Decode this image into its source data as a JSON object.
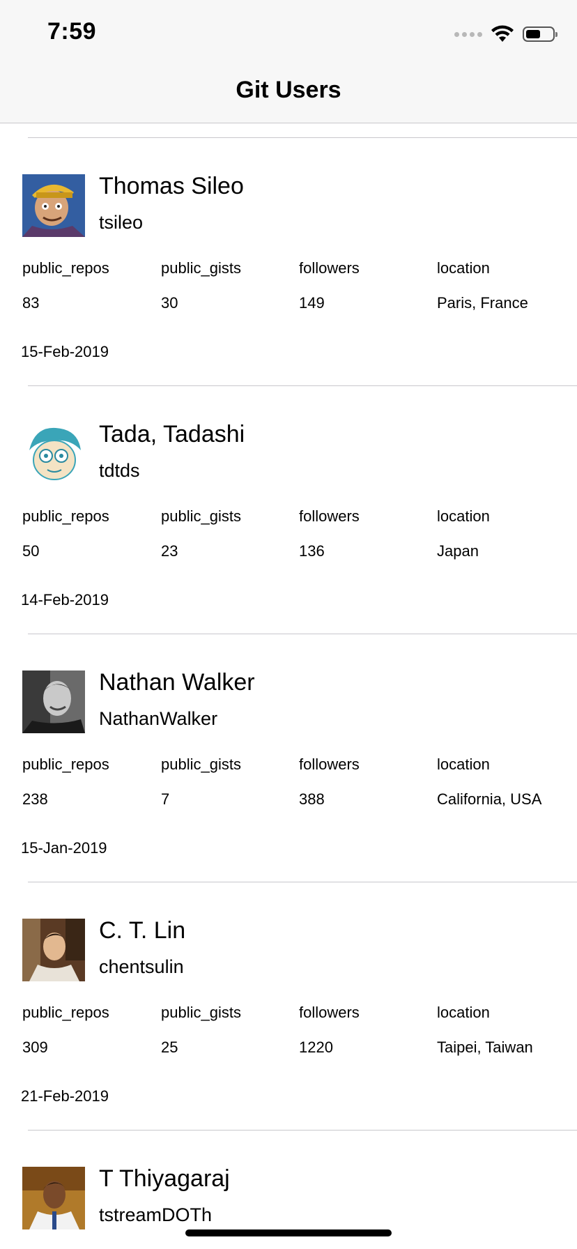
{
  "status_bar": {
    "time": "7:59"
  },
  "nav": {
    "title": "Git Users"
  },
  "users": [
    {
      "name": "Thomas Sileo",
      "login": "tsileo",
      "labels": [
        "public_repos",
        "public_gists",
        "followers",
        "location"
      ],
      "values": [
        "83",
        "30",
        "149",
        "Paris, France"
      ],
      "date": "15-Feb-2019",
      "avatar_icon": "cartoon-portrait"
    },
    {
      "name": "Tada, Tadashi",
      "login": "tdtds",
      "labels": [
        "public_repos",
        "public_gists",
        "followers",
        "location"
      ],
      "values": [
        "50",
        "23",
        "136",
        "Japan"
      ],
      "date": "14-Feb-2019",
      "avatar_icon": "cartoon-face"
    },
    {
      "name": "Nathan Walker",
      "login": "NathanWalker",
      "labels": [
        "public_repos",
        "public_gists",
        "followers",
        "location"
      ],
      "values": [
        "238",
        "7",
        "388",
        "California, USA"
      ],
      "date": "15-Jan-2019",
      "avatar_icon": "photo-portrait"
    },
    {
      "name": "C. T. Lin",
      "login": "chentsulin",
      "labels": [
        "public_repos",
        "public_gists",
        "followers",
        "location"
      ],
      "values": [
        "309",
        "25",
        "1220",
        "Taipei, Taiwan"
      ],
      "date": "21-Feb-2019",
      "avatar_icon": "photo-portrait"
    },
    {
      "name": "T Thiyagaraj",
      "login": "tstreamDOTh",
      "avatar_icon": "photo-portrait"
    }
  ]
}
